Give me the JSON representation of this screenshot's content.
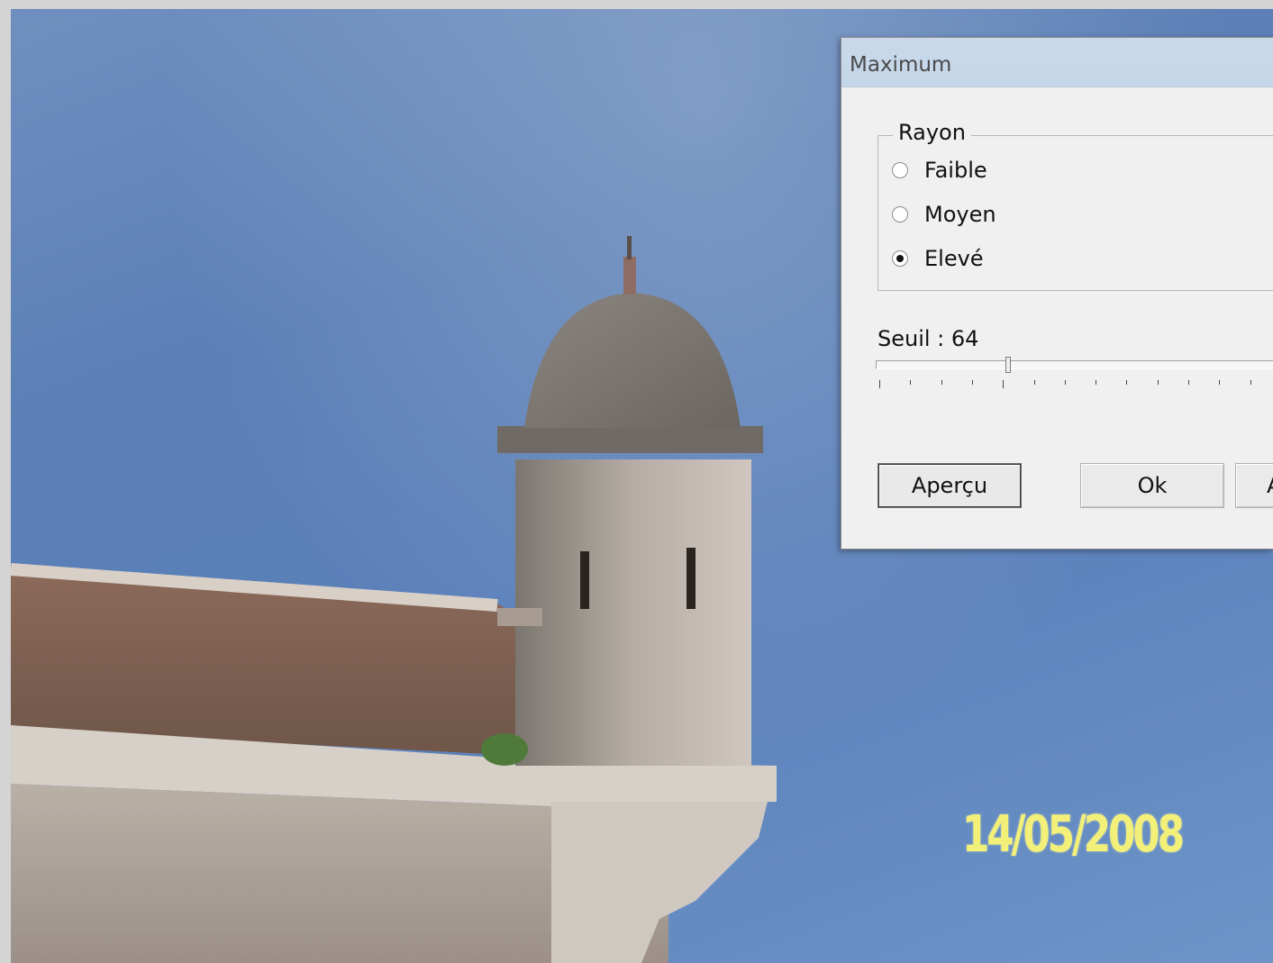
{
  "photo": {
    "date_stamp": "14/05/2008",
    "description_colors": {
      "sky": "#5b7fb6",
      "stamp": "#f3f07a"
    }
  },
  "dialog": {
    "title": "Maximum",
    "rayon": {
      "legend": "Rayon",
      "options": [
        {
          "label": "Faible",
          "checked": false
        },
        {
          "label": "Moyen",
          "checked": false
        },
        {
          "label": "Elevé",
          "checked": true
        }
      ]
    },
    "seuil": {
      "label": "Seuil : 64",
      "value": 64
    },
    "buttons": {
      "preview": "Aperçu",
      "ok": "Ok",
      "cancel_partial": "A"
    }
  }
}
